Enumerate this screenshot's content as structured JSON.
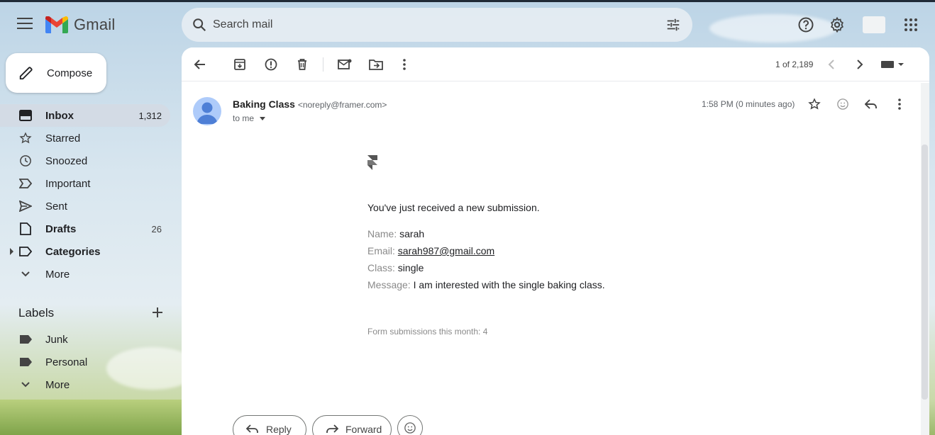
{
  "app": {
    "name": "Gmail"
  },
  "search": {
    "placeholder": "Search mail"
  },
  "sidebar": {
    "compose_label": "Compose",
    "items": [
      {
        "label": "Inbox",
        "count": "1,312"
      },
      {
        "label": "Starred",
        "count": ""
      },
      {
        "label": "Snoozed",
        "count": ""
      },
      {
        "label": "Important",
        "count": ""
      },
      {
        "label": "Sent",
        "count": ""
      },
      {
        "label": "Drafts",
        "count": "26"
      },
      {
        "label": "Categories",
        "count": ""
      },
      {
        "label": "More",
        "count": ""
      }
    ],
    "labels_title": "Labels",
    "labels": [
      {
        "label": "Junk"
      },
      {
        "label": "Personal"
      },
      {
        "label": "More"
      }
    ]
  },
  "toolbar": {
    "pager": "1 of 2,189"
  },
  "message": {
    "sender_name": "Baking Class",
    "sender_email": "<noreply@framer.com>",
    "to": "to me",
    "time": "1:58 PM (0 minutes ago)",
    "intro": "You've just received a new submission.",
    "fields": {
      "name_key": "Name:",
      "name_val": "sarah",
      "email_key": "Email:",
      "email_val": "sarah987@gmail.com",
      "class_key": "Class:",
      "class_val": "single",
      "message_key": "Message:",
      "message_val": "I am interested with the single baking class."
    },
    "footer": "Form submissions this month: 4"
  },
  "actions": {
    "reply": "Reply",
    "forward": "Forward"
  },
  "colors": {
    "gmail_red": "#EA4335",
    "gmail_blue": "#4285F4",
    "gmail_green": "#34A853",
    "gmail_yellow": "#FBBC04",
    "active_nav": "#d3dbe5"
  }
}
